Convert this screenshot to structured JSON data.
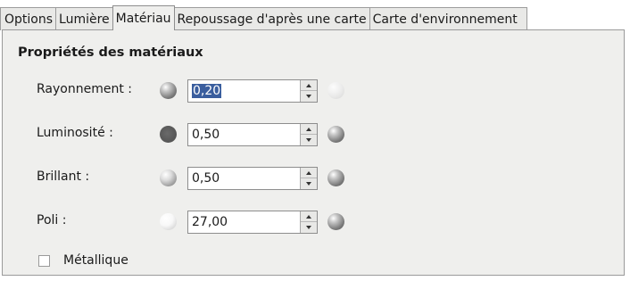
{
  "tabs": [
    {
      "label": "Options",
      "active": false
    },
    {
      "label": "Lumière",
      "active": false
    },
    {
      "label": "Matériau",
      "active": true
    },
    {
      "label": "Repoussage d'après une carte",
      "active": false
    },
    {
      "label": "Carte d'environnement",
      "active": false
    }
  ],
  "section_title": "Propriétés des matériaux",
  "properties": [
    {
      "label": "Rayonnement :",
      "value": "0,20",
      "selected": true
    },
    {
      "label": "Luminosité :",
      "value": "0,50",
      "selected": false
    },
    {
      "label": "Brillant :",
      "value": "0,50",
      "selected": false
    },
    {
      "label": "Poli :",
      "value": "27,00",
      "selected": false
    }
  ],
  "metallic": {
    "label": "Métallique",
    "checked": false
  },
  "colors": {
    "selection": "#3a5e9e",
    "panel": "#efefed"
  },
  "icons": {
    "preview_low": "sphere-preview-icon",
    "preview_high": "sphere-preview-icon",
    "spin_up": "arrow-up-icon",
    "spin_down": "arrow-down-icon"
  }
}
